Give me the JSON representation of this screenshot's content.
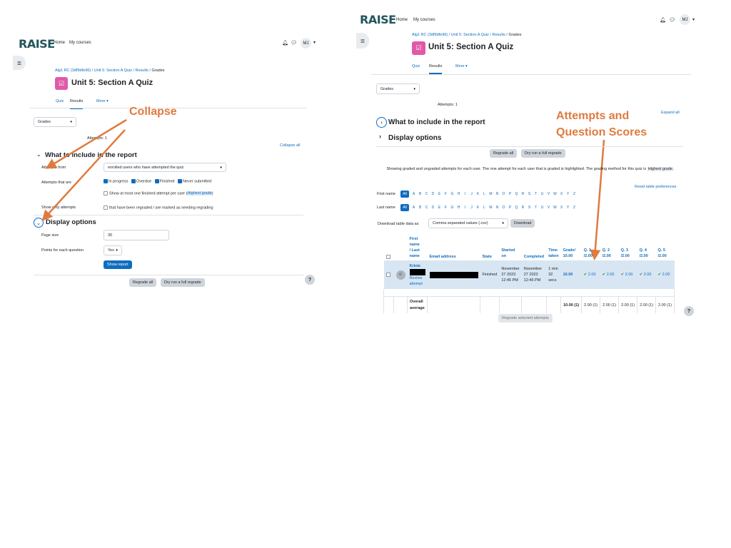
{
  "left": {
    "logo": "RAISE",
    "nav": {
      "home": "Home",
      "courses": "My courses"
    },
    "avatar": "MJ",
    "breadcrumb": {
      "c1": "Alg1 RC (3df9dfe96)",
      "c2": "Unit 5: Section A Quiz",
      "c3": "Results",
      "c4": "Grades"
    },
    "title": "Unit 5: Section A Quiz",
    "tabs": {
      "quiz": "Quiz",
      "results": "Results",
      "more": "More ▾"
    },
    "grades_select": "Grades",
    "attempts": "Attempts: 1",
    "collapse_all": "Collapse all",
    "section1": "What to include in the report",
    "attempts_from_label": "Attempts from",
    "attempts_from_value": "enrolled users who have attempted the quiz",
    "attempts_that_are_label": "Attempts that are",
    "states": {
      "s1": "In progress",
      "s2": "Overdue",
      "s3": "Finished",
      "s4": "Never submitted"
    },
    "show_one_a": "Show at most one finished attempt per user (",
    "show_one_link": "Highest grade",
    "show_one_b": ")",
    "show_only_label": "Show only attempts",
    "show_only_value": "that have been regraded / are marked as needing regrading",
    "section2": "Display options",
    "page_size_label": "Page size",
    "page_size_value": "30",
    "points_label": "Points for each question",
    "points_value": "Yes",
    "show_report": "Show report",
    "regrade_all": "Regrade all",
    "dry_run": "Dry run a full regrade",
    "help": "?"
  },
  "right": {
    "logo": "RAISE",
    "nav": {
      "home": "Home",
      "courses": "My courses"
    },
    "avatar": "MJ",
    "breadcrumb": {
      "c1": "Alg1 RC (3df9dfe96)",
      "c2": "Unit 5: Section A Quiz",
      "c3": "Results",
      "c4": "Grades"
    },
    "title": "Unit 5: Section A Quiz",
    "tabs": {
      "quiz": "Quiz",
      "results": "Results",
      "more": "More ▾"
    },
    "grades_select": "Grades",
    "attempts": "Attempts: 1",
    "expand_all": "Expand all",
    "section1": "What to include in the report",
    "section2": "Display options",
    "regrade_all": "Regrade all",
    "dry_run": "Dry run a full regrade",
    "info": "Showing graded and ungraded attempts for each user. The one attempt for each user that is graded is highlighted. The grading method for this quiz is",
    "info_method": "Highest grade",
    "reset_prefs": "Reset table preferences",
    "first_name": "First name",
    "last_name": "Last name",
    "letters": [
      "All",
      "A",
      "B",
      "C",
      "D",
      "E",
      "F",
      "G",
      "H",
      "I",
      "J",
      "K",
      "L",
      "M",
      "N",
      "O",
      "P",
      "Q",
      "R",
      "S",
      "T",
      "U",
      "V",
      "W",
      "X",
      "Y",
      "Z"
    ],
    "download_label": "Download table data as",
    "download_format": "Comma separated values (.csv)",
    "download_btn": "Download",
    "table": {
      "h_first": "First",
      "h_name": "name",
      "h_last": "/ Last",
      "h_name2": "name",
      "h_email": "Email address",
      "h_state": "State",
      "h_started1": "Started",
      "h_started2": "on",
      "h_completed": "Completed",
      "h_time1": "Time",
      "h_time2": "taken",
      "h_grade1": "Grade/",
      "h_grade2": "10.00",
      "q_heads": [
        "Q. 1",
        "Q. 2",
        "Q. 3",
        "Q. 4",
        "Q. 5"
      ],
      "q_sub": "/2.00",
      "row_name": "Kriste",
      "row_review1": "Review",
      "row_review2": "attempt",
      "row_state": "Finished",
      "row_started1": "November",
      "row_started2": "27 2023",
      "row_started3": "12:45 PM",
      "row_completed1": "November",
      "row_completed2": "27 2023",
      "row_completed3": "12:46 PM",
      "row_time1": "1 min",
      "row_time2": "32",
      "row_time3": "secs",
      "row_grade": "10.00",
      "row_q": [
        "2.00",
        "2.00",
        "2.00",
        "2.00",
        "2.00"
      ],
      "avg_label1": "Overall",
      "avg_label2": "average",
      "avg_grade": "10.00 (1)",
      "avg_q": [
        "2.00 (1)",
        "2.00 (1)",
        "2.00 (1)",
        "2.00 (1)",
        "2.00 (1)"
      ]
    },
    "regrade_selected": "Regrade selected attempts",
    "help": "?"
  },
  "annotations": {
    "collapse": "Collapse",
    "attempts_scores_1": "Attempts and",
    "attempts_scores_2": "Question Scores"
  },
  "colors": {
    "accent": "#0f6cbf",
    "annotation": "#e07a3e",
    "logo": "#23555c",
    "quiz_icon": "#e05aa8",
    "highlight": "#d8e6f3"
  }
}
